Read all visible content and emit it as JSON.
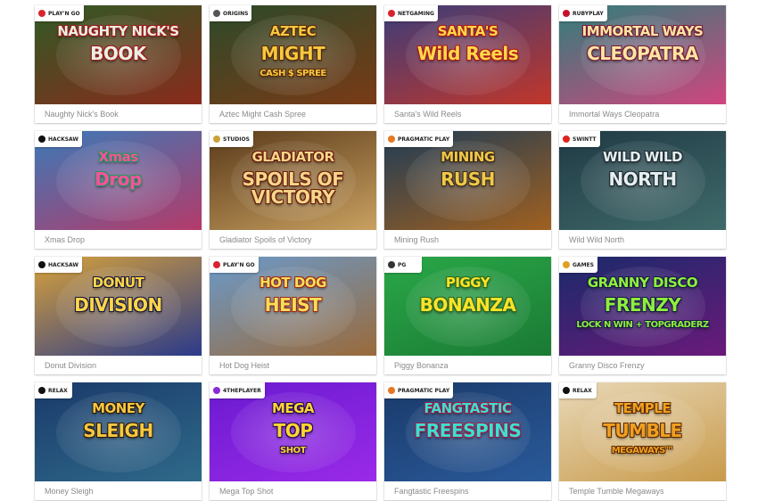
{
  "games": [
    {
      "name": "Naughty Nick's Book",
      "art_line1": "NAUGHTY NICK'S",
      "art_line2": "BOOK",
      "art_line3": "",
      "provider": "PLAY'N GO",
      "provider_color": "#d9232e",
      "bg1": "#2f5a25",
      "bg2": "#8a2a1c",
      "text_color": "#e8f0e4",
      "stroke": "#a01818"
    },
    {
      "name": "Aztec Might Cash Spree",
      "art_line1": "AZTEC",
      "art_line2": "MIGHT",
      "art_line3": "CASH $ SPREE",
      "provider": "ORIGINS",
      "provider_color": "#555555",
      "bg1": "#2b4a2a",
      "bg2": "#7a3a16",
      "text_color": "#f5c842",
      "stroke": "#5a2a05"
    },
    {
      "name": "Santa's Wild Reels",
      "art_line1": "SANTA'S",
      "art_line2": "Wild Reels",
      "art_line3": "",
      "provider": "netgaming",
      "provider_color": "#d9232e",
      "bg1": "#3a3d7a",
      "bg2": "#c2362a",
      "text_color": "#ffd84a",
      "stroke": "#b01818"
    },
    {
      "name": "Immortal Ways Cleopatra",
      "art_line1": "IMMORTAL WAYS",
      "art_line2": "CLEOPATRA",
      "art_line3": "",
      "provider": "RUBYPLAY",
      "provider_color": "#c8102e",
      "bg1": "#2f7f7a",
      "bg2": "#d0457f",
      "text_color": "#fbe6a2",
      "stroke": "#7a1a3a"
    },
    {
      "name": "Xmas Drop",
      "art_line1": "Xmas",
      "art_line2": "Drop",
      "art_line3": "",
      "provider": "HACKSAW",
      "provider_color": "#111111",
      "bg1": "#3a7ab8",
      "bg2": "#b53a6a",
      "text_color": "#ff4fa0",
      "stroke": "#1e9a5a"
    },
    {
      "name": "Gladiator Spoils of Victory",
      "art_line1": "GLADIATOR",
      "art_line2": "SPOILS OF VICTORY",
      "art_line3": "",
      "provider": "STUDIOS",
      "provider_color": "#c9a23a",
      "bg1": "#5a3a1a",
      "bg2": "#c8a060",
      "text_color": "#f6d68a",
      "stroke": "#6a1a0a"
    },
    {
      "name": "Mining Rush",
      "art_line1": "MINING",
      "art_line2": "RUSH",
      "art_line3": "",
      "provider": "PRAGMATIC PLAY",
      "provider_color": "#e87722",
      "bg1": "#1f3c55",
      "bg2": "#a06020",
      "text_color": "#f0c848",
      "stroke": "#3a2a1a"
    },
    {
      "name": "Wild Wild North",
      "art_line1": "WILD WILD",
      "art_line2": "NORTH",
      "art_line3": "",
      "provider": "Swintt",
      "provider_color": "#e2231a",
      "bg1": "#203a45",
      "bg2": "#3f6a6a",
      "text_color": "#e6eef0",
      "stroke": "#1a2a30"
    },
    {
      "name": "Donut Division",
      "art_line1": "DONUT",
      "art_line2": "DIVISION",
      "art_line3": "",
      "provider": "HACKSAW",
      "provider_color": "#111111",
      "bg1": "#d8a23a",
      "bg2": "#2a3a8a",
      "text_color": "#ffd64a",
      "stroke": "#1a1a3a"
    },
    {
      "name": "Hot Dog Heist",
      "art_line1": "HOT DOG",
      "art_line2": "HEIST",
      "art_line3": "",
      "provider": "PLAY'N GO",
      "provider_color": "#d9232e",
      "bg1": "#6a9acb",
      "bg2": "#9a6a3a",
      "text_color": "#f6e05a",
      "stroke": "#a02818"
    },
    {
      "name": "Piggy Bonanza",
      "art_line1": "PIGGY",
      "art_line2": "BONANZA",
      "art_line3": "",
      "provider": "PG",
      "provider_color": "#333333",
      "bg1": "#2aa848",
      "bg2": "#1a7a34",
      "text_color": "#ffe22a",
      "stroke": "#2a6a1a"
    },
    {
      "name": "Granny Disco Frenzy",
      "art_line1": "GRANNY DISCO",
      "art_line2": "FRENZY",
      "art_line3": "LOCK N WIN + TOPGRADERZ",
      "provider": "GAMES",
      "provider_color": "#e0a020",
      "bg1": "#1a2a6a",
      "bg2": "#6a1a7a",
      "text_color": "#8ef03a",
      "stroke": "#1a1a4a"
    },
    {
      "name": "Money Sleigh",
      "art_line1": "MONEY",
      "art_line2": "SLEIGH",
      "art_line3": "",
      "provider": "RELAX",
      "provider_color": "#111111",
      "bg1": "#1a3a6a",
      "bg2": "#2f6a8a",
      "text_color": "#f5c842",
      "stroke": "#2a1a0a"
    },
    {
      "name": "Mega Top Shot",
      "art_line1": "MEGA",
      "art_line2": "TOP",
      "art_line3": "SHOT",
      "provider": "4ThePlayer",
      "provider_color": "#8a2ad8",
      "bg1": "#6a1ad0",
      "bg2": "#9a2ae8",
      "text_color": "#ffd630",
      "stroke": "#2a0a5a"
    },
    {
      "name": "Fangtastic Freespins",
      "art_line1": "FANGTASTIC",
      "art_line2": "FREESPINS",
      "art_line3": "",
      "provider": "PRAGMATIC PLAY",
      "provider_color": "#e87722",
      "bg1": "#1a3a6a",
      "bg2": "#2a5a9a",
      "text_color": "#3ae0d0",
      "stroke": "#a01a4a"
    },
    {
      "name": "Temple Tumble Megaways",
      "art_line1": "TEMPLE",
      "art_line2": "TUMBLE",
      "art_line3": "MEGAWAYS™",
      "provider": "RELAX",
      "provider_color": "#111111",
      "bg1": "#e8d8b8",
      "bg2": "#c89a4a",
      "text_color": "#f0a020",
      "stroke": "#5a2a05"
    }
  ]
}
